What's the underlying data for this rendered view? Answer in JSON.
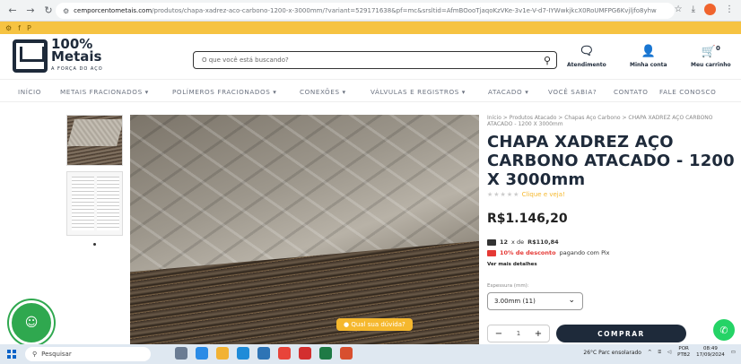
{
  "browser": {
    "url_host": "cemporcentometais.com",
    "url_path": "/produtos/chapa-xadrez-aco-carbono-1200-x-3000mm/?variant=529171638&pf=mc&srsltid=AfmBOooTjaqoKzVKe-3v1e-V-d7-IYWwkjkcX0RoUMFPG6Kvjljfo8yhw"
  },
  "top_strip": {
    "icons": [
      "settings-icon",
      "facebook-icon",
      "pinterest-icon"
    ]
  },
  "header": {
    "logo_line1": "100%",
    "logo_line2": "Metais",
    "logo_tagline": "A FORÇA DO AÇO",
    "search_placeholder": "O que você está buscando?",
    "atendimento": "Atendimento",
    "minha_conta": "Minha conta",
    "carrinho": "Meu carrinho",
    "cart_count": "0"
  },
  "nav": [
    "INÍCIO",
    "METAIS FRACIONADOS ▾",
    "POLÍMEROS FRACIONADOS ▾",
    "CONEXÕES ▾",
    "VÁLVULAS E REGISTROS ▾",
    "ATACADO ▾",
    "VOCÊ SABIA?",
    "CONTATO",
    "FALE CONOSCO"
  ],
  "product": {
    "breadcrumb": "Início > Produtos Atacado > Chapas Aço Carbono > CHAPA XADREZ AÇO CARBONO ATACADO - 1200 X 3000mm",
    "title": "CHAPA XADREZ AÇO CARBONO ATACADO - 1200 X 3000mm",
    "rating_link": "Clique e veja!",
    "price": "R$1.146,20",
    "installments_count": "12",
    "installments_mid": "x de ",
    "installment_value": "R$110,84",
    "pix_discount": "10% de desconto",
    "pix_rest": " pagando com Pix",
    "details_link": "Ver mais detalhes",
    "thickness_label": "Espessura (mm):",
    "thickness_value": "3.00mm (11)",
    "quantity": "1",
    "buy_label": "COMPRAR",
    "question_label": "● Qual sua dúvida?"
  },
  "taskbar": {
    "search_placeholder": "Pesquisar",
    "weather": "26°C  Parc ensolarado",
    "lang": "POR\nPTB2",
    "time": "08:49",
    "date": "17/09/2024"
  }
}
